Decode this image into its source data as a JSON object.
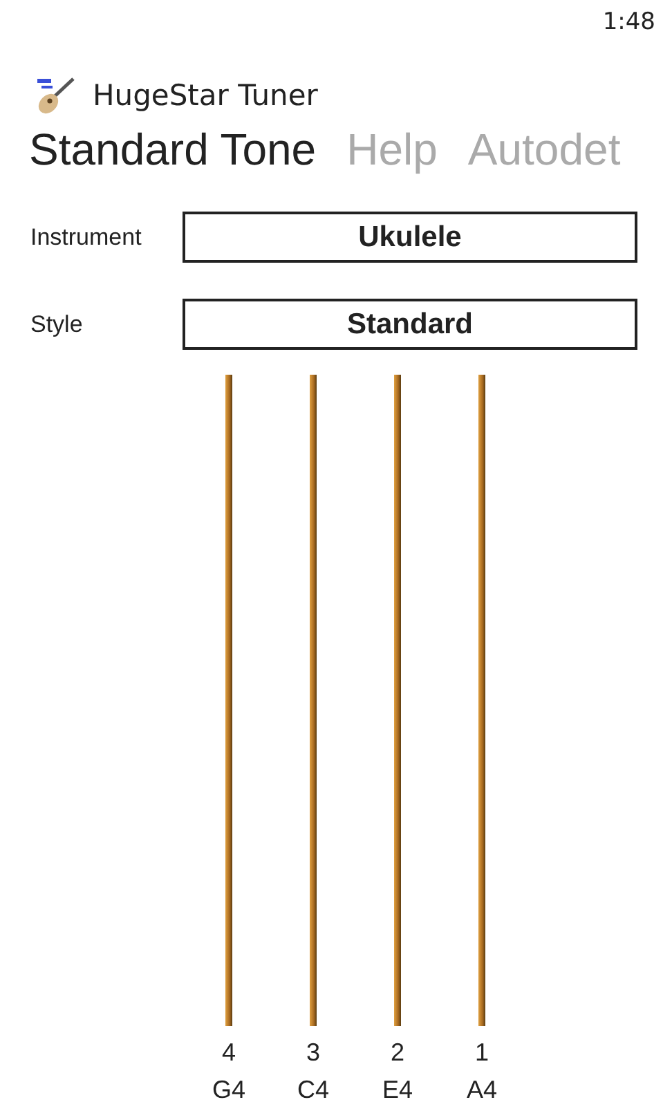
{
  "status_bar": {
    "time": "1:48"
  },
  "app": {
    "title": "HugeStar Tuner"
  },
  "pivot": [
    {
      "label": "Standard Tone",
      "selected": true
    },
    {
      "label": "Help",
      "selected": false
    },
    {
      "label": "Autodet",
      "selected": false
    }
  ],
  "fields": [
    {
      "label": "Instrument",
      "value": "Ukulele"
    },
    {
      "label": "Style",
      "value": "Standard"
    }
  ],
  "strings": [
    {
      "number": "4",
      "note": "G4"
    },
    {
      "number": "3",
      "note": "C4"
    },
    {
      "number": "2",
      "note": "E4"
    },
    {
      "number": "1",
      "note": "A4"
    }
  ]
}
